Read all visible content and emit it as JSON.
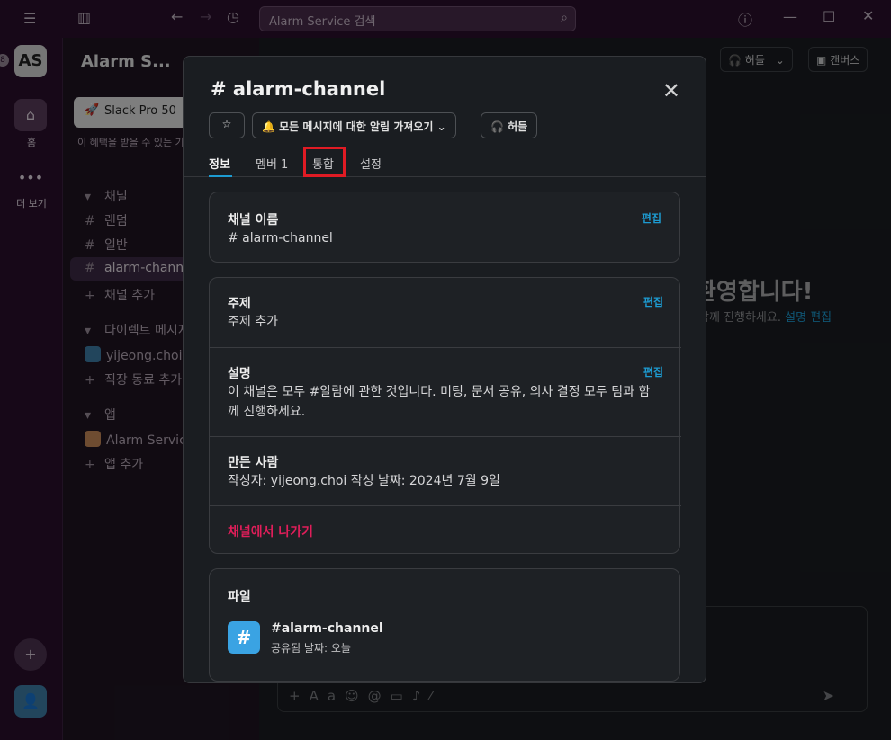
{
  "titlebar": {
    "search_placeholder": "Alarm Service 검색",
    "icons": [
      "menu-icon",
      "sidebar-toggle-icon",
      "back-arrow-icon",
      "forward-arrow-icon",
      "history-icon",
      "help-icon",
      "minimize-icon",
      "maximize-icon",
      "close-icon"
    ]
  },
  "rail": {
    "workspace_initials": "AS",
    "badge": "8",
    "home_label": "홈",
    "more_label": "더 보기"
  },
  "sidebar": {
    "workspace_name": "Alarm S...",
    "pro_button": "Slack Pro 50",
    "pro_subtitle": "이 혜택을 받을 수 있는 기",
    "sections": {
      "channels": "채널",
      "direct": "다이렉트 메시지",
      "apps": "앱"
    },
    "channels": [
      "랜덤",
      "일반",
      "alarm-channel"
    ],
    "add_channel": "채널 추가",
    "dm_user": "yijeong.choi",
    "add_coworker": "직장 동료 추가",
    "app_item": "Alarm Service",
    "add_app": "앱 추가"
  },
  "main": {
    "huddle_label": "허들",
    "canvas_label": "캔버스",
    "welcome_text": "환영합니다!",
    "welcome_sub_prefix": "함께 진행하세요.",
    "welcome_sub_link": "설명 편집"
  },
  "modal": {
    "title": "# alarm-channel",
    "notify_button": "모든 메시지에 대한 알림 가져오기",
    "huddle_button": "허들",
    "tabs": [
      "정보",
      "멤버 1",
      "통합",
      "설정"
    ],
    "channel_name_label": "채널 이름",
    "channel_name_value": "# alarm-channel",
    "edit_label": "편집",
    "topic_label": "주제",
    "topic_value": "주제 추가",
    "description_label": "설명",
    "description_value": "이 채널은 모두 #알람에 관한 것입니다. 미팅, 문서 공유, 의사 결정 모두 팀과 함께 진행하세요.",
    "creator_label": "만든 사람",
    "creator_value": "작성자: yijeong.choi 작성 날짜: 2024년 7월 9일",
    "leave_label": "채널에서 나가기",
    "files_label": "파일",
    "file_name": "#alarm-channel",
    "file_sub": "공유됨 날짜: 오늘"
  },
  "colors": {
    "accent": "#1d9bd1",
    "danger": "#e01e5a",
    "highlight": "#e01b24",
    "aubergine": "#2a0f2c"
  }
}
